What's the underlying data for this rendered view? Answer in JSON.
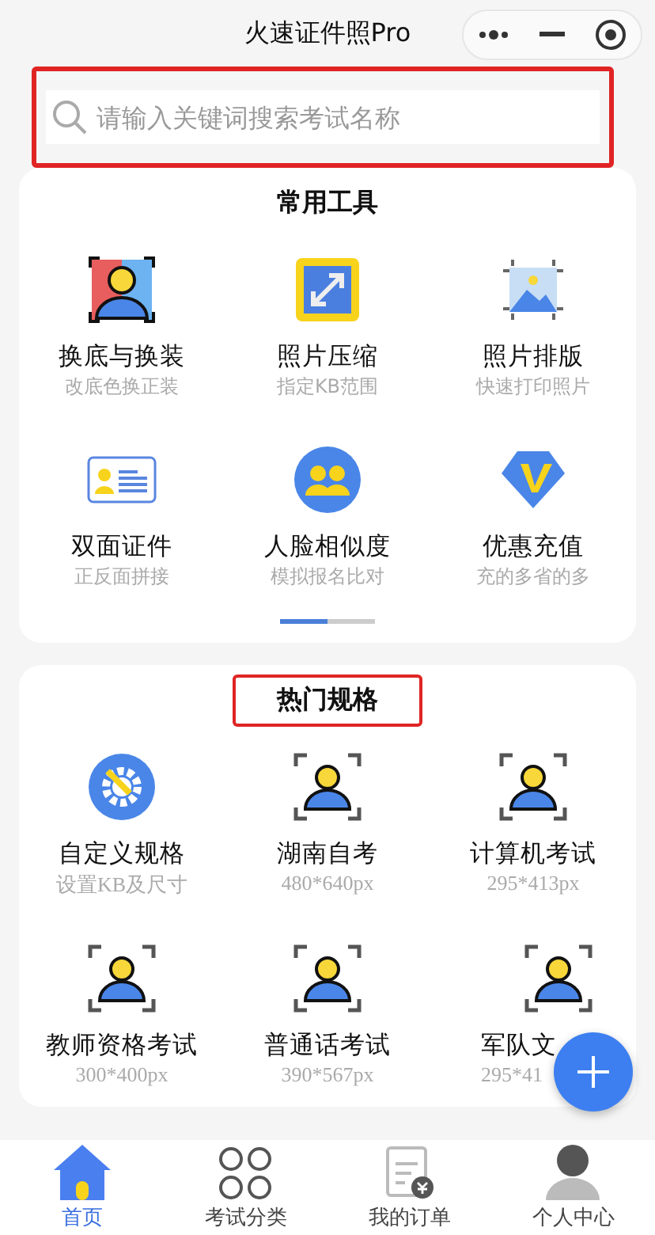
{
  "nav": {
    "title": "火速证件照Pro"
  },
  "search": {
    "placeholder": "请输入关键词搜索考试名称",
    "highlighted": true
  },
  "tools": {
    "title": "常用工具",
    "highlighted": false,
    "items": [
      {
        "kind": "swap",
        "name": "换底与换装",
        "sub": "改底色换正装"
      },
      {
        "kind": "compress",
        "name": "照片压缩",
        "sub": "指定KB范围"
      },
      {
        "kind": "layout",
        "name": "照片排版",
        "sub": "快速打印照片"
      },
      {
        "kind": "idcard",
        "name": "双面证件",
        "sub": "正反面拼接"
      },
      {
        "kind": "faces",
        "name": "人脸相似度",
        "sub": "模拟报名比对"
      },
      {
        "kind": "vip",
        "name": "优惠充值",
        "sub": "充的多省的多"
      }
    ],
    "pager": [
      {
        "selected": true
      },
      {
        "selected": false
      }
    ]
  },
  "hot": {
    "title": "热门规格",
    "highlighted": true,
    "items": [
      {
        "kind": "custom",
        "name": "自定义规格",
        "sub": "设置KB及尺寸"
      },
      {
        "kind": "portrait",
        "name": "湖南自考",
        "sub": "480*640px"
      },
      {
        "kind": "portrait",
        "name": "计算机考试",
        "sub": "295*413px"
      },
      {
        "kind": "portrait",
        "name": "教师资格考试",
        "sub": "300*400px"
      },
      {
        "kind": "portrait",
        "name": "普通话考试",
        "sub": "390*567px"
      },
      {
        "kind": "portrait",
        "name": "军队文",
        "sub": "295*41"
      }
    ]
  },
  "tabs": [
    {
      "kind": "home",
      "label": "首页",
      "selected": true
    },
    {
      "kind": "category",
      "label": "考试分类",
      "selected": false
    },
    {
      "kind": "order",
      "label": "我的订单",
      "selected": false
    },
    {
      "kind": "user",
      "label": "个人中心",
      "selected": false
    }
  ]
}
